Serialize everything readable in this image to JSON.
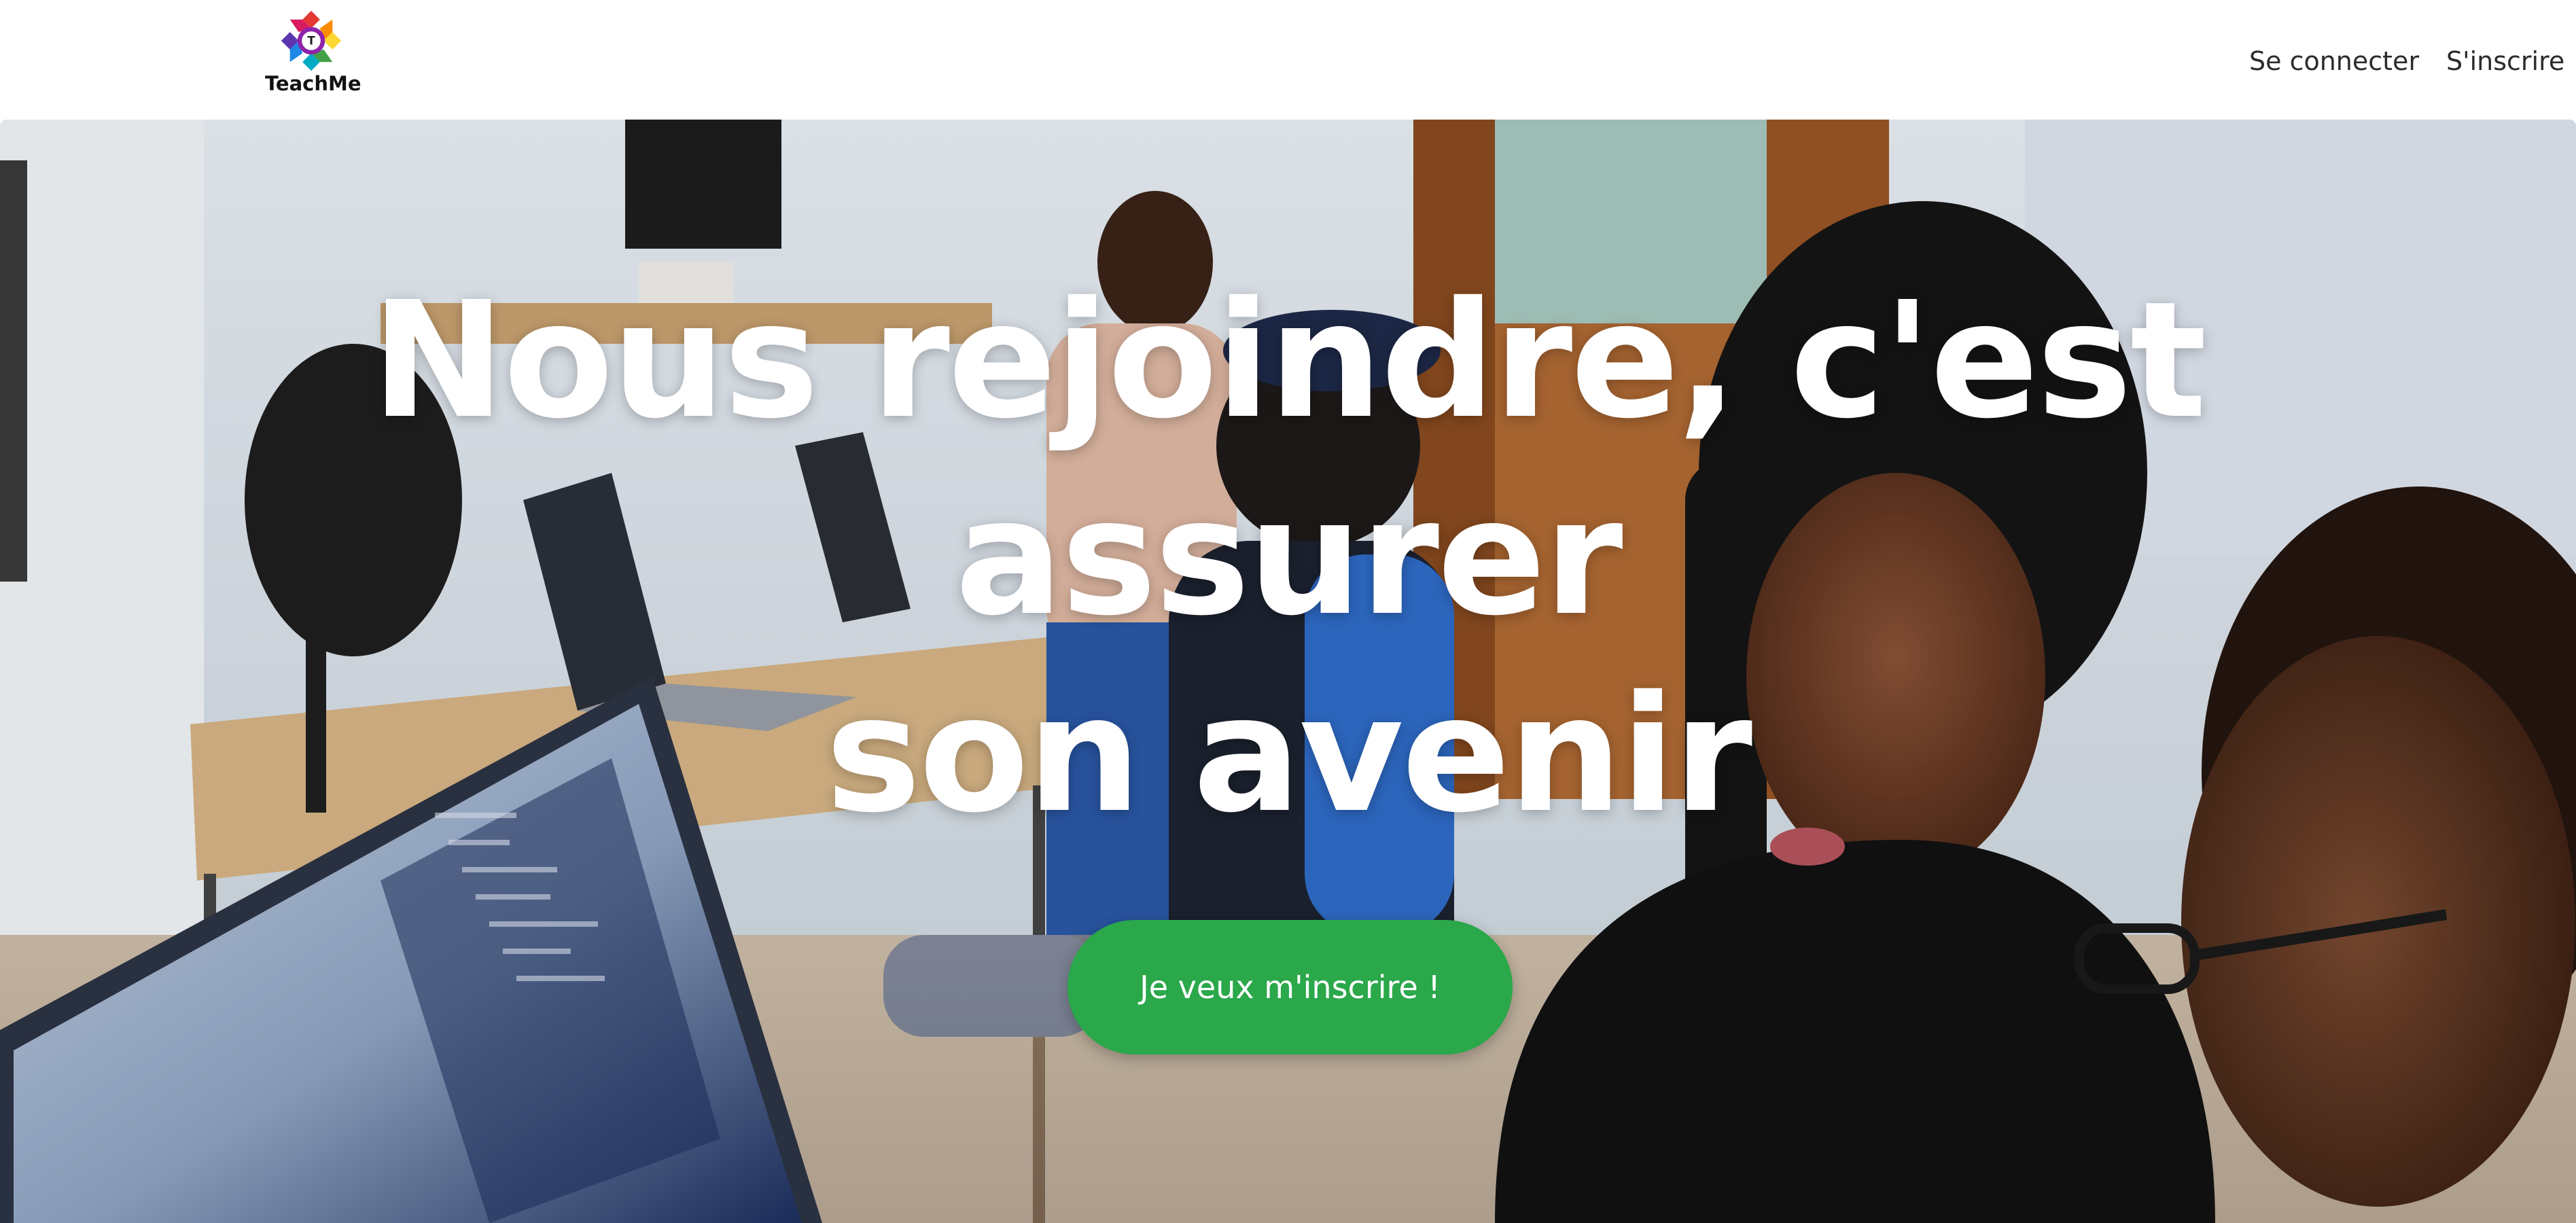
{
  "navbar": {
    "brand_name": "TeachMe",
    "brand_logo_letter": "T",
    "login_label": "Se connecter",
    "register_label": "S'inscrire"
  },
  "hero": {
    "title_line1": "Nous rejoindre, c'est assurer",
    "title_line2": "son avenir",
    "cta_label": "Je veux m'inscrire !"
  },
  "colors": {
    "cta_green": "#2aa84a",
    "nav_text": "#2b2b2b",
    "hero_title": "#ffffff"
  },
  "icons": {
    "brand_logo": "colorful-flower-logo-icon"
  }
}
